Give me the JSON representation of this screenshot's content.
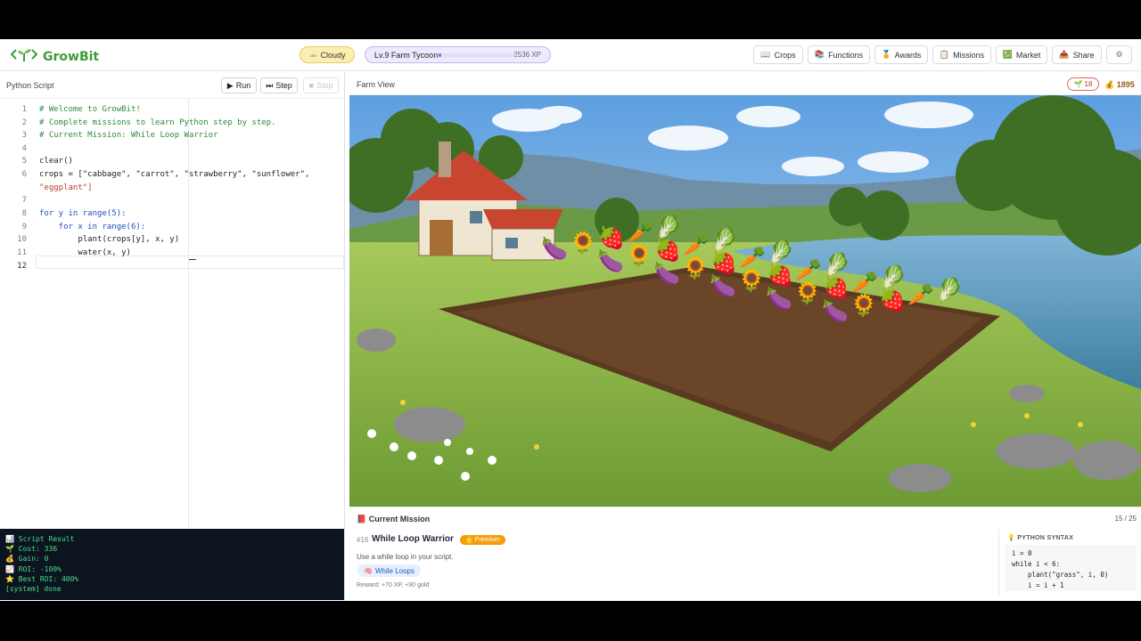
{
  "app": {
    "name": "GrowBit"
  },
  "header": {
    "weather": "Cloudy",
    "level_label": "Lv.9 Farm Tycoon",
    "xp": "2536 XP",
    "xp_progress": 0.03,
    "nav": [
      {
        "label": "Crops",
        "icon": "book-icon"
      },
      {
        "label": "Functions",
        "icon": "books-icon"
      },
      {
        "label": "Awards",
        "icon": "medal-icon"
      },
      {
        "label": "Missions",
        "icon": "clipboard-icon"
      },
      {
        "label": "Market",
        "icon": "chart-icon"
      },
      {
        "label": "Share",
        "icon": "upload-icon"
      }
    ],
    "settings_icon": "gear-icon"
  },
  "editor": {
    "title": "Python Script",
    "run": "Run",
    "step": "Step",
    "stop": "Stop",
    "lines": [
      "# Welcome to GrowBit!",
      "# Complete missions to learn Python step by step.",
      "# Current Mission: While Loop Warrior",
      "",
      "clear()",
      "crops = [\"cabbage\", \"carrot\", \"strawberry\", \"sunflower\",",
      "\"eggplant\"]",
      "",
      "for y in range(5):",
      "    for x in range(6):",
      "        plant(crops[y], x, y)",
      "        water(x, y)",
      ""
    ],
    "line_numbers": [
      "1",
      "2",
      "3",
      "",
      "4",
      "5",
      "6",
      "",
      "7",
      "8",
      "9",
      "10",
      "11",
      "12"
    ]
  },
  "console": {
    "title": "Script Result",
    "cost": "Cost: 336",
    "gain": "Gain: 0",
    "roi": "ROI: -100%",
    "best_roi": "Best ROI: 400%",
    "system": "[system] done"
  },
  "farm": {
    "title": "Farm View",
    "seeds": "18",
    "gold": "1895"
  },
  "mission": {
    "header": "Current Mission",
    "progress": "15 / 25",
    "number": "#16",
    "title": "While Loop Warrior",
    "badge": "Premium",
    "description": "Use a while loop in your script.",
    "tag": "While Loops",
    "reward": "Reward: +70 XP, +90 gold",
    "syntax_title": "PYTHON SYNTAX",
    "syntax_lines": [
      "i = 0",
      "while i < 6:",
      "    plant(\"grass\", i, 0)",
      "    i = i + 1"
    ]
  },
  "colors": {
    "brand": "#3f9b3a",
    "console_bg": "#0c1420",
    "console_text": "#4ade80",
    "premium": "#f59e0b"
  }
}
